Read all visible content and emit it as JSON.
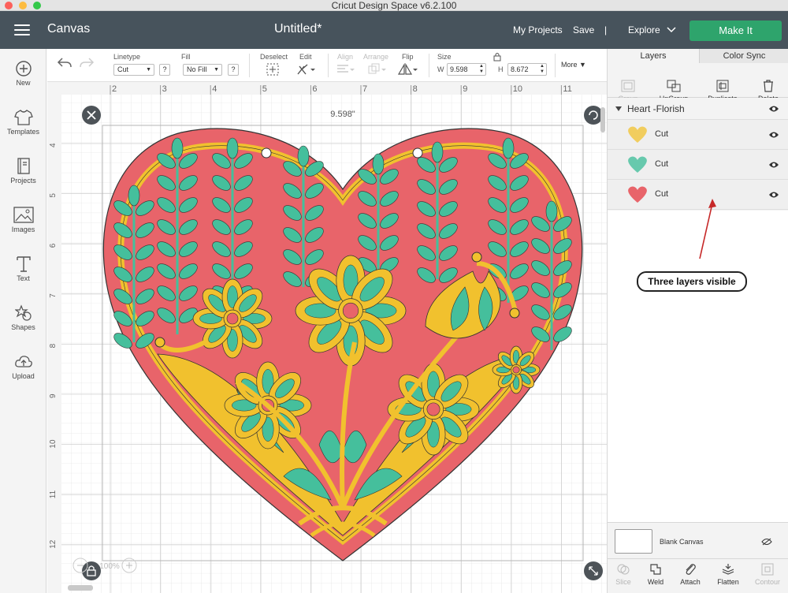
{
  "window": {
    "title": "Cricut Design Space  v6.2.100"
  },
  "header": {
    "canvas_label": "Canvas",
    "document_title": "Untitled*",
    "my_projects": "My Projects",
    "save": "Save",
    "divider": "|",
    "explore": "Explore",
    "make_it": "Make It",
    "make_it_color": "#2ea46c"
  },
  "leftbar": {
    "items": [
      {
        "label": "New",
        "icon": "plus-circle-icon"
      },
      {
        "label": "Templates",
        "icon": "tshirt-icon"
      },
      {
        "label": "Projects",
        "icon": "book-icon"
      },
      {
        "label": "Images",
        "icon": "image-icon"
      },
      {
        "label": "Text",
        "icon": "text-t-icon"
      },
      {
        "label": "Shapes",
        "icon": "shapes-icon"
      },
      {
        "label": "Upload",
        "icon": "upload-cloud-icon"
      }
    ]
  },
  "toolbar": {
    "linetype_label": "Linetype",
    "linetype_value": "Cut",
    "fill_label": "Fill",
    "fill_value": "No Fill",
    "help": "?",
    "deselect_label": "Deselect",
    "edit_label": "Edit",
    "align_label": "Align",
    "arrange_label": "Arrange",
    "flip_label": "Flip",
    "size_label": "Size",
    "w_label": "W",
    "w_value": "9.598",
    "h_label": "H",
    "h_value": "8.672",
    "more_label": "More"
  },
  "canvas": {
    "width_readout": "9.598\"",
    "ruler_top": [
      "2",
      "3",
      "4",
      "5",
      "6",
      "7",
      "8",
      "9",
      "10",
      "11"
    ],
    "ruler_left": [
      "4",
      "5",
      "6",
      "7",
      "8",
      "9",
      "10",
      "11",
      "12"
    ],
    "zoom": "100%",
    "design_colors": {
      "base": "#e8646a",
      "middle": "#f1c12e",
      "top": "#45bf9c"
    }
  },
  "rightpanel": {
    "tabs": [
      "Layers",
      "Color Sync"
    ],
    "actions": [
      {
        "label": "Group",
        "icon": "group-icon",
        "enabled": false
      },
      {
        "label": "UnGroup",
        "icon": "ungroup-icon",
        "enabled": true
      },
      {
        "label": "Duplicate",
        "icon": "duplicate-icon",
        "enabled": true
      },
      {
        "label": "Delete",
        "icon": "trash-icon",
        "enabled": true
      }
    ],
    "group_name": "Heart -Florish",
    "layers": [
      {
        "label": "Cut",
        "color": "#f1c12e"
      },
      {
        "label": "Cut",
        "color": "#45bf9c"
      },
      {
        "label": "Cut",
        "color": "#e8646a"
      }
    ],
    "blank_canvas": "Blank Canvas",
    "bottom_actions": [
      {
        "label": "Slice",
        "icon": "slice-icon",
        "enabled": false
      },
      {
        "label": "Weld",
        "icon": "weld-icon",
        "enabled": true
      },
      {
        "label": "Attach",
        "icon": "paperclip-icon",
        "enabled": true
      },
      {
        "label": "Flatten",
        "icon": "flatten-icon",
        "enabled": true
      },
      {
        "label": "Contour",
        "icon": "contour-icon",
        "enabled": false
      }
    ]
  },
  "annotation": {
    "text": "Three layers visible"
  }
}
